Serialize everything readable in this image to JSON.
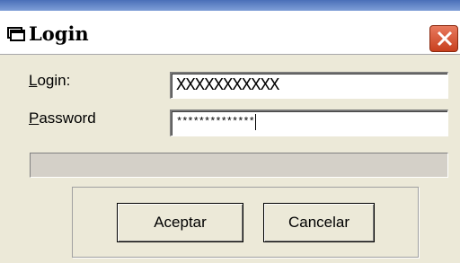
{
  "window": {
    "title": "Login",
    "icon": "window-icon",
    "close_icon": "close-icon"
  },
  "form": {
    "login_label": "Login:",
    "login_accel": "L",
    "login_rest": "ogin:",
    "login_value": "XXXXXXXXXXX",
    "password_label": "Password",
    "password_accel": "P",
    "password_rest": "assword",
    "password_value": "**************"
  },
  "progress": {
    "value": 0
  },
  "buttons": {
    "accept_label": "Aceptar",
    "cancel_label": "Cancelar"
  },
  "colors": {
    "close_button": "#d44a2a",
    "progress_fill": "#316ac5",
    "dialog_background": "#ece9d8"
  }
}
